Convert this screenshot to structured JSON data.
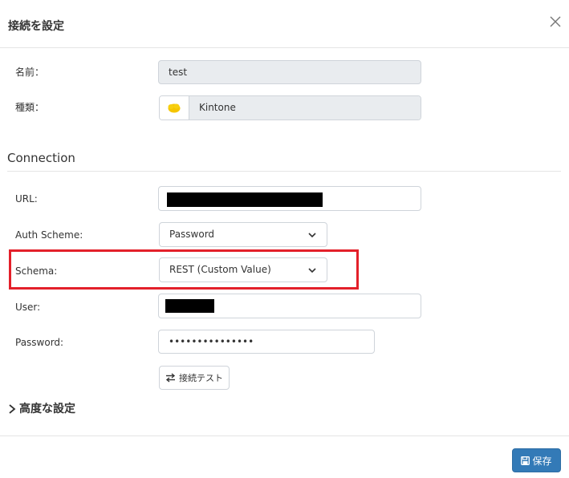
{
  "header": {
    "title": "接続を設定",
    "close_icon": "close-icon"
  },
  "fields": {
    "name_label": "名前：",
    "name_value": "test",
    "type_label": "種類：",
    "type_value": "Kintone",
    "type_icon": "kintone-logo-icon"
  },
  "connection": {
    "section_title": "Connection",
    "url_label": "URL:",
    "auth_label": "Auth Scheme:",
    "auth_value": "Password",
    "schema_label": "Schema:",
    "schema_value": "REST (Custom Value)",
    "user_label": "User:",
    "password_label": "Password:",
    "password_value": "•••••••••••••••",
    "test_button": "接続テスト",
    "highlight_color": "#e3202a"
  },
  "advanced": {
    "label": "高度な設定"
  },
  "footer": {
    "save_button": "保存",
    "save_color": "#337ab7"
  }
}
